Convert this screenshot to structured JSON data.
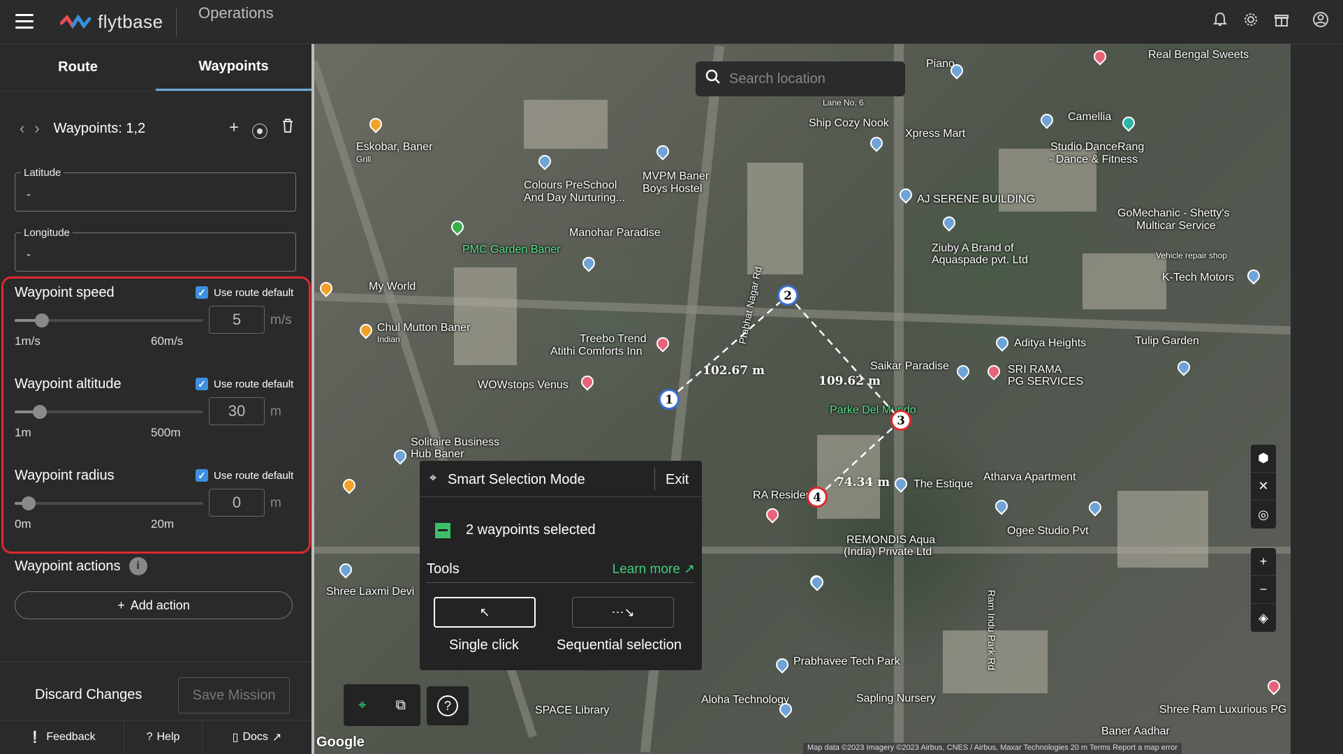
{
  "header": {
    "logo_text": "flytbase",
    "app_title": "Operations"
  },
  "sidebar": {
    "tabs": [
      {
        "label": "Route"
      },
      {
        "label": "Waypoints"
      }
    ],
    "waypoints_title": "Waypoints: 1,2",
    "latitude": {
      "label": "Latitude",
      "value": "-"
    },
    "longitude": {
      "label": "Longitude",
      "value": "-"
    },
    "speed": {
      "title": "Waypoint speed",
      "checkbox_label": "Use route default",
      "checked": true,
      "value": "5",
      "unit": "m/s",
      "min": "1m/s",
      "max": "60m/s",
      "level": 0.07
    },
    "altitude": {
      "title": "Waypoint altitude",
      "checkbox_label": "Use route default",
      "checked": true,
      "value": "30",
      "unit": "m",
      "min": "1m",
      "max": "500m",
      "level": 0.06
    },
    "radius": {
      "title": "Waypoint radius",
      "checkbox_label": "Use route default",
      "checked": true,
      "value": "0",
      "unit": "m",
      "min": "0m",
      "max": "20m",
      "level": 0.0
    },
    "actions_title": "Waypoint actions",
    "add_action_label": "Add action",
    "discard_label": "Discard Changes",
    "save_label": "Save Mission",
    "footer": [
      {
        "label": "Feedback"
      },
      {
        "label": "Help"
      },
      {
        "label": "Docs"
      }
    ]
  },
  "map": {
    "search_placeholder": "Search location",
    "labels": [
      "Eskobar, Baner",
      "Grill",
      "Colours PreSchool",
      "And Day Nurturing...",
      "MVPM Baner",
      "Boys Hostel",
      "PMC Garden Baner",
      "Manohar Paradise",
      "Chul Mutton Baner",
      "Indian",
      "Treebo Trend",
      "Atithi Comforts Inn",
      "WOWstops Venus",
      "Solitaire Business",
      "Hub Baner",
      "Parke Del Mundo",
      "RA Residency",
      "The Estique",
      "Atharva Apartment",
      "Ogee Studio Pvt",
      "REMONDIS Aqua",
      "(India) Private Ltd",
      "Lane No. 6",
      "Ship Cozy Nook",
      "Xpress Mart",
      "Camellia",
      "Studio DanceRang",
      "- Dance & Fitness",
      "AJ SERENE BUILDING",
      "GoMechanic - Shetty's",
      "Multicar Service",
      "Vehicle repair shop",
      "Ziuby A Brand of",
      "Aquaspade pvt. Ltd",
      "K-Tech Motors",
      "Aditya Heights",
      "Tulip Garden",
      "Saikar Paradise",
      "SRI RAMA",
      "PG SERVICES",
      "Real Bengal Sweets",
      "Shree Laxmi Devi",
      "Prabhavee Tech Park",
      "Aloha Technology",
      "Sapling Nursery",
      "SPACE Library",
      "Shree Ram Luxurious PG",
      "Baner Aadhar",
      "Prabhat Nagar Rd",
      "Ram Indu Park Rd",
      "My World",
      "Piano"
    ],
    "distances": [
      "102.67 m",
      "109.62 m",
      "74.34 m"
    ],
    "waypoints": [
      "1",
      "2",
      "3",
      "4"
    ],
    "attribution": "Map data ©2023 Imagery ©2023 Airbus, CNES / Airbus, Maxar Technologies   20 m   Terms   Report a map error",
    "google": "Google"
  },
  "smart_selection": {
    "title": "Smart Selection Mode",
    "exit_label": "Exit",
    "selected_text": "2 waypoints selected",
    "tools_label": "Tools",
    "learn_more": "Learn more",
    "single_click": "Single click",
    "sequential": "Sequential selection"
  },
  "colors": {
    "accent_green": "#3fcf7a",
    "highlight_red": "#e0282e",
    "checkbox_blue": "#3d8fe0"
  }
}
